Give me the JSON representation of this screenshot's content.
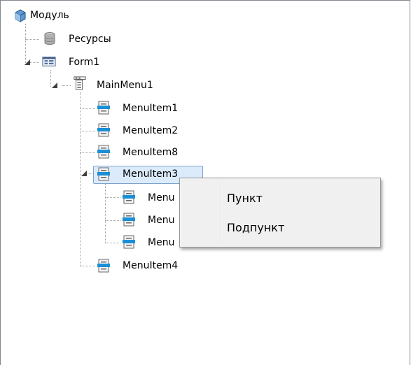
{
  "tree": {
    "root": {
      "label": "Модуль",
      "icon": "module-icon"
    },
    "resources": {
      "label": "Ресурсы",
      "icon": "database-icon"
    },
    "form": {
      "label": "Form1",
      "icon": "form-icon"
    },
    "mainmenu": {
      "label": "MainMenu1",
      "icon": "mainmenu-icon"
    },
    "items": [
      {
        "label": "MenuItem1",
        "icon": "menuitem-icon"
      },
      {
        "label": "MenuItem2",
        "icon": "menuitem-icon"
      },
      {
        "label": "MenuItem8",
        "icon": "menuitem-icon"
      },
      {
        "label": "MenuItem3",
        "icon": "menuitem-icon",
        "selected": true
      }
    ],
    "subitems_visible": [
      "Menu",
      "Menu",
      "Menu"
    ],
    "last_item": {
      "label": "MenuItem4",
      "icon": "menuitem-icon"
    }
  },
  "context_menu": {
    "items": [
      {
        "label": "Пункт"
      },
      {
        "label": "Подпункт"
      }
    ]
  },
  "colors": {
    "selection_bg": "#dcebfc",
    "selection_border": "#7da2ce",
    "menuitem_icon": "#1b8fd6",
    "menu_bg": "#f0f0f0"
  }
}
